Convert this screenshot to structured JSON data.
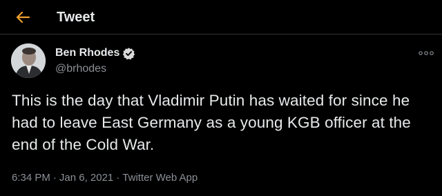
{
  "header": {
    "title": "Tweet",
    "back_icon": "arrow-left-icon",
    "accent_color": "#f0a030"
  },
  "author": {
    "name": "Ben Rhodes",
    "handle": "@brhodes",
    "verified_icon": "verified-badge-icon",
    "avatar_icon": "profile-photo"
  },
  "menu": {
    "icon": "more-options-icon"
  },
  "tweet": {
    "text": "This is the day that Vladimir Putin has waited for since he had to leave East Germany as a young KGB officer at the end of the Cold War."
  },
  "meta": {
    "time": "6:34 PM",
    "separator": "·",
    "date": "Jan 6, 2021",
    "source": "Twitter Web App"
  },
  "colors": {
    "background": "#000000",
    "text": "#e7e9ea",
    "secondary_text": "#8b9096",
    "divider": "#2f3336"
  }
}
